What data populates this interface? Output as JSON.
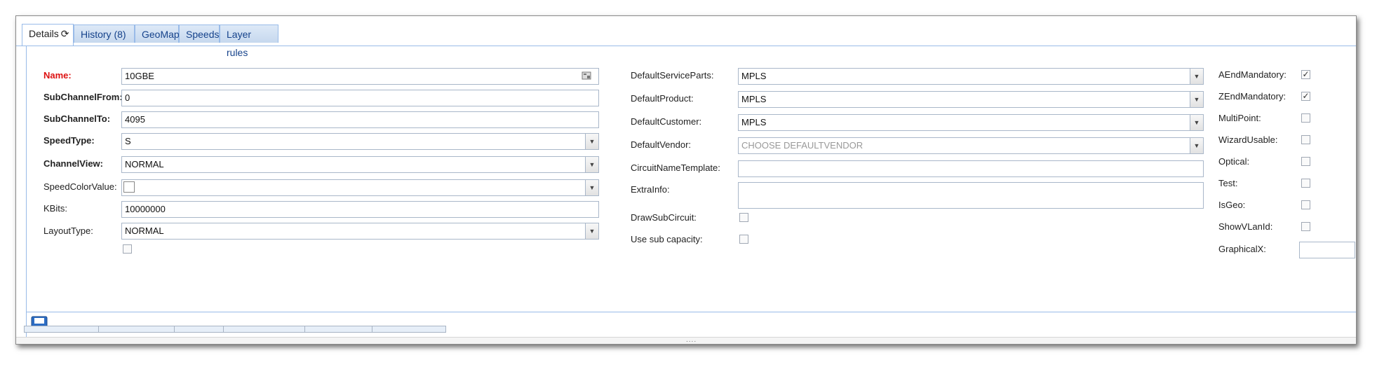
{
  "tabs": [
    {
      "label": "Details"
    },
    {
      "label": "History (8)"
    },
    {
      "label": "GeoMap"
    },
    {
      "label": "Speeds"
    },
    {
      "label": "Layer rules"
    }
  ],
  "tab_refresh_glyph": "⟳",
  "left": {
    "name": {
      "label": "Name:",
      "value": "10GBE"
    },
    "subchannel_from": {
      "label": "SubChannelFrom:",
      "value": "0"
    },
    "subchannel_to": {
      "label": "SubChannelTo:",
      "value": "4095"
    },
    "speed_type": {
      "label": "SpeedType:",
      "value": "S"
    },
    "channel_view": {
      "label": "ChannelView:",
      "value": "NORMAL"
    },
    "speed_color_value": {
      "label": "SpeedColorValue:",
      "value": ""
    },
    "kbits": {
      "label": "KBits:",
      "value": "10000000"
    },
    "layout_type": {
      "label": "LayoutType:",
      "value": "NORMAL"
    }
  },
  "middle": {
    "default_service_parts": {
      "label": "DefaultServiceParts:",
      "value": "MPLS"
    },
    "default_product": {
      "label": "DefaultProduct:",
      "value": "MPLS"
    },
    "default_customer": {
      "label": "DefaultCustomer:",
      "value": "MPLS"
    },
    "default_vendor": {
      "label": "DefaultVendor:",
      "placeholder": "CHOOSE DEFAULTVENDOR"
    },
    "circuit_name_template": {
      "label": "CircuitNameTemplate:",
      "value": ""
    },
    "extra_info": {
      "label": "ExtraInfo:",
      "value": ""
    },
    "draw_sub_circuit": {
      "label": "DrawSubCircuit:",
      "checked": false
    },
    "use_sub_capacity": {
      "label": "Use sub capacity:",
      "checked": false
    }
  },
  "right": {
    "a_end_mandatory": {
      "label": "AEndMandatory:",
      "checked": true
    },
    "z_end_mandatory": {
      "label": "ZEndMandatory:",
      "checked": true
    },
    "multi_point": {
      "label": "MultiPoint:",
      "checked": false
    },
    "wizard_usable": {
      "label": "WizardUsable:",
      "checked": false
    },
    "optical": {
      "label": "Optical:",
      "checked": false
    },
    "test": {
      "label": "Test:",
      "checked": false
    },
    "is_geo": {
      "label": "IsGeo:",
      "checked": false
    },
    "show_vlan_id": {
      "label": "ShowVLanId:",
      "checked": false
    },
    "graphical_x": {
      "label": "GraphicalX:",
      "value": ""
    }
  },
  "check_glyph": "✓",
  "dropdown_glyph": "▼",
  "splitter_grip": "....",
  "colors": {
    "required": "#dd1111",
    "tab_text": "#15428b",
    "border": "#99bbe8"
  }
}
